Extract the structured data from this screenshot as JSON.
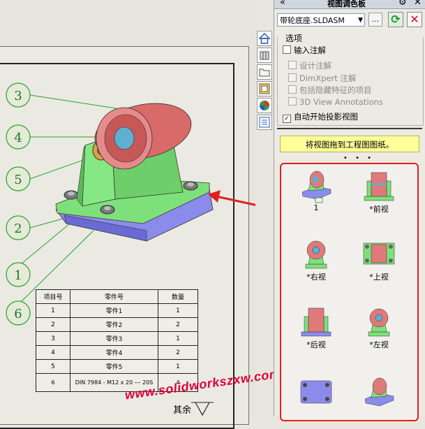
{
  "panel": {
    "title": "视图调色板",
    "document": "带轮底座.SLDASM",
    "browse_label": "...",
    "options_title": "选项",
    "options": [
      {
        "label": "输入注解",
        "checked": false,
        "enabled": true
      },
      {
        "label": "设计注解",
        "checked": false,
        "enabled": false
      },
      {
        "label": "DimXpert 注解",
        "checked": false,
        "enabled": false
      },
      {
        "label": "包括隐藏特征的项目",
        "checked": false,
        "enabled": false
      },
      {
        "label": "3D View Annotations",
        "checked": false,
        "enabled": false
      },
      {
        "label": "自动开始投影视图",
        "checked": true,
        "enabled": true
      }
    ],
    "hint": "将视图拖到工程图图纸。",
    "views": [
      {
        "label": "1",
        "icon": "isometric-view-icon"
      },
      {
        "label": "*前视",
        "icon": "front-view-icon"
      },
      {
        "label": "*右视",
        "icon": "right-view-icon"
      },
      {
        "label": "*上视",
        "icon": "top-view-icon"
      },
      {
        "label": "*后视",
        "icon": "back-view-icon"
      },
      {
        "label": "*左视",
        "icon": "left-view-icon"
      },
      {
        "label": "",
        "icon": "bottom-view-icon"
      },
      {
        "label": "",
        "icon": "trimetric-view-icon"
      }
    ]
  },
  "side_icons": [
    "home-icon",
    "parts-icon",
    "folder-icon",
    "view-palette-icon",
    "appearance-icon",
    "properties-icon"
  ],
  "drawing": {
    "balloons": [
      "3",
      "4",
      "5",
      "2",
      "1",
      "6"
    ],
    "bom": {
      "headers": [
        "项目号",
        "零件号",
        "数量"
      ],
      "rows": [
        [
          "1",
          "零件1",
          "1"
        ],
        [
          "2",
          "零件2",
          "2"
        ],
        [
          "3",
          "零件3",
          "1"
        ],
        [
          "4",
          "零件4",
          "2"
        ],
        [
          "5",
          "零件5",
          "1"
        ],
        [
          "6",
          "DIN 7984 - M12 x 20 --- 20S",
          "4"
        ]
      ]
    },
    "rest_label": "其余",
    "watermark": "www.solidworkszxw.com"
  },
  "colors": {
    "balloon": "#1b7a1b",
    "accent_red": "#e02020",
    "hint_bg": "#ffff9a",
    "part_green": "#7ce07a",
    "part_pink": "#e07a7a",
    "part_blue": "#8888e8"
  }
}
